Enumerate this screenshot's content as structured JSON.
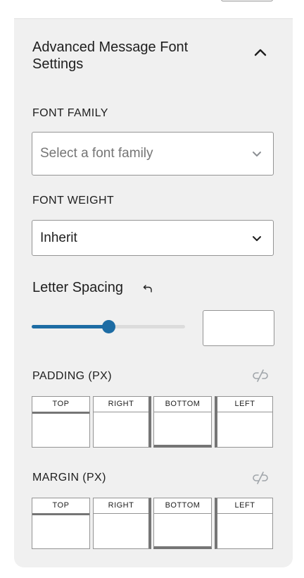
{
  "panel": {
    "title": "Advanced Message Font Settings"
  },
  "font_family": {
    "label": "FONT FAMILY",
    "placeholder": "Select a font family"
  },
  "font_weight": {
    "label": "FONT WEIGHT",
    "value": "Inherit"
  },
  "letter_spacing": {
    "label": "Letter Spacing",
    "slider_fraction": 0.5,
    "value": ""
  },
  "padding": {
    "label": "PADDING (PX)",
    "sides": {
      "top": "TOP",
      "right": "RIGHT",
      "bottom": "BOTTOM",
      "left": "LEFT"
    }
  },
  "margin": {
    "label": "MARGIN (PX)",
    "sides": {
      "top": "TOP",
      "right": "RIGHT",
      "bottom": "BOTTOM",
      "left": "LEFT"
    }
  },
  "icons": {
    "collapse": "chevron-up-icon",
    "select": "chevron-down-icon",
    "reset": "undo-icon",
    "unlink": "unlink-icon"
  },
  "colors": {
    "accent": "#1d6ca4",
    "panel_bg": "#f0f0f0",
    "border": "#949494",
    "placeholder_text": "#757575",
    "icon_muted": "#a0a5aa"
  }
}
